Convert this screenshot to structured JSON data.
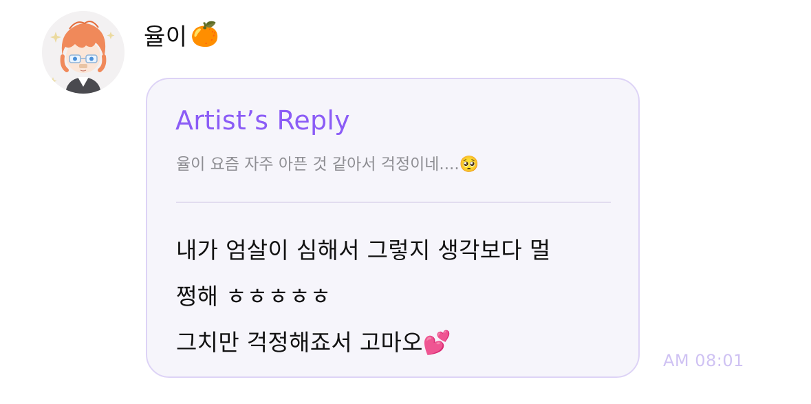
{
  "message": {
    "sender_name": "율이",
    "sender_emoji": "🍊",
    "reply": {
      "label": "Artist’s Reply",
      "quoted_text": "율이 요즘 자주 아픈 것 같아서 걱정이네....🥺",
      "body_lines": [
        "내가 엄살이 심해서 그렇지 생각보다 멀",
        "쩡해 ㅎㅎㅎㅎㅎ",
        "그치만 걱정해죠서 고마오💕"
      ]
    },
    "timestamp": "AM 08:01"
  },
  "colors": {
    "accent_purple": "#8b5cf6",
    "bubble_border": "#ddd3f6",
    "bubble_background": "#f6f5fb",
    "timestamp": "#cfc2f3",
    "quoted_text": "#8e8e93"
  },
  "icons": {
    "avatar": "chibi-orange-haired-character-avatar"
  }
}
